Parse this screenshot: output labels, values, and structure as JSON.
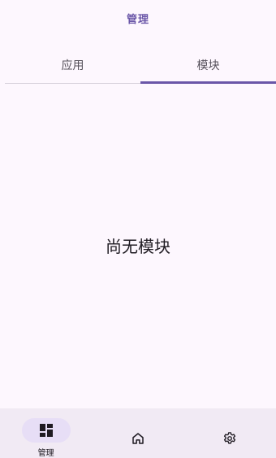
{
  "header": {
    "title": "管理"
  },
  "tabs": [
    {
      "label": "应用",
      "active": false
    },
    {
      "label": "模块",
      "active": true
    }
  ],
  "main": {
    "empty_message": "尚无模块"
  },
  "bottom_nav": {
    "items": [
      {
        "label": "管理",
        "icon": "dashboard-icon",
        "active": true
      },
      {
        "label": "",
        "icon": "home-icon",
        "active": false
      },
      {
        "label": "",
        "icon": "gear-icon",
        "active": false
      }
    ]
  },
  "colors": {
    "background": "#fdf7fe",
    "accent": "#6a56a8",
    "nav_background": "#f1eaf4",
    "nav_active_pill": "#e7def6"
  }
}
